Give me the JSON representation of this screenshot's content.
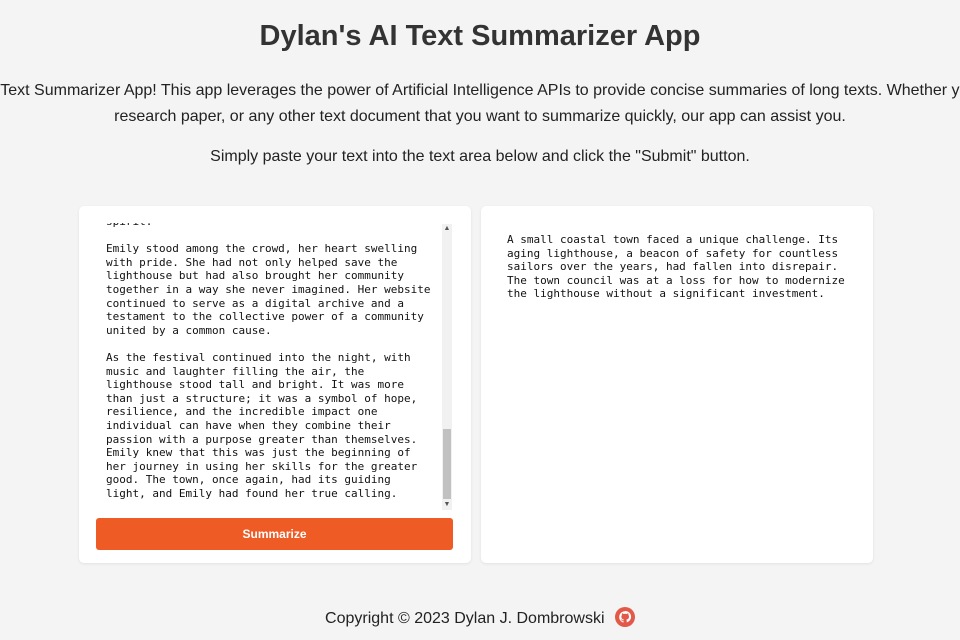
{
  "header": {
    "title": "Dylan's AI Text Summarizer App"
  },
  "intro": {
    "line1": "Welcome to Dylan's AI Text Summarizer App! This app leverages the power of Artificial Intelligence APIs to provide concise summaries of long texts. Whether you have a news article,",
    "line2": "research paper, or any other text document that you want to summarize quickly, our app can assist you."
  },
  "instructions": "Simply paste your text into the text area below and click the \"Submit\" button.",
  "input": {
    "text": "spirit.\n\nEmily stood among the crowd, her heart swelling with pride. She had not only helped save the lighthouse but had also brought her community together in a way she never imagined. Her website continued to serve as a digital archive and a testament to the collective power of a community united by a common cause.\n\nAs the festival continued into the night, with music and laughter filling the air, the lighthouse stood tall and bright. It was more than just a structure; it was a symbol of hope, resilience, and the incredible impact one individual can have when they combine their passion with a purpose greater than themselves. Emily knew that this was just the beginning of her journey in using her skills for the greater good. The town, once again, had its guiding light, and Emily had found her true calling.",
    "scroll_position": 0.85
  },
  "button": {
    "label": "Summarize",
    "color": "#ef5b25"
  },
  "output": {
    "text": "A small coastal town faced a unique challenge. Its aging lighthouse, a beacon of safety for countless sailors over the years, had fallen into disrepair. The town council was at a loss for how to modernize the lighthouse without a significant investment."
  },
  "footer": {
    "copyright": "Copyright © 2023 Dylan J. Dombrowski",
    "icon": "github-icon",
    "icon_color": "#e2594a"
  }
}
